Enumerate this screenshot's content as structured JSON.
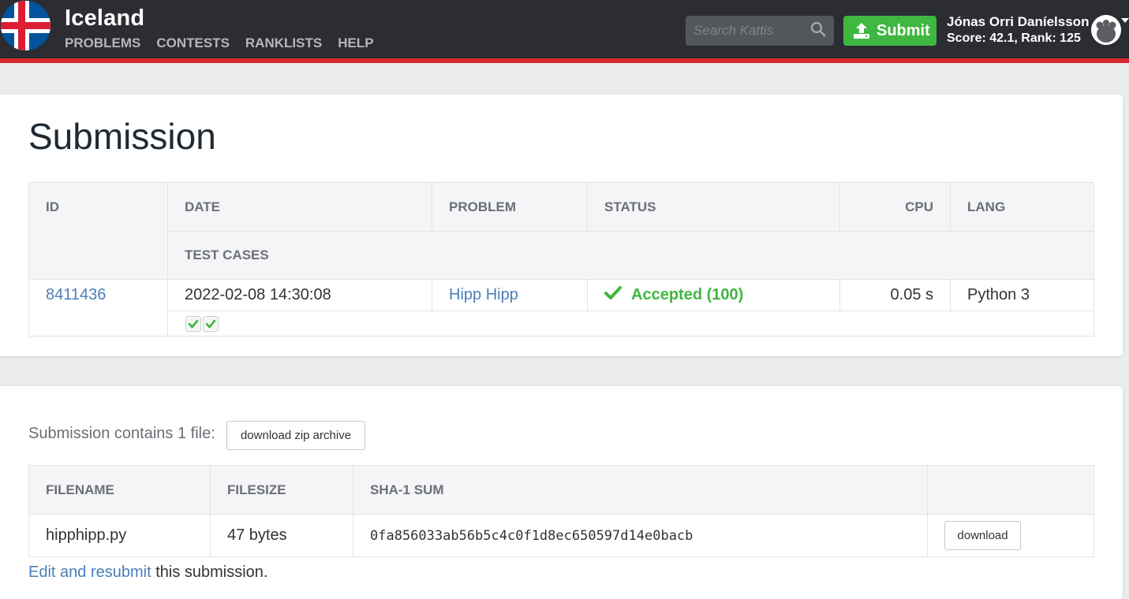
{
  "header": {
    "brand": "Iceland",
    "nav": [
      "PROBLEMS",
      "CONTESTS",
      "RANKLISTS",
      "HELP"
    ],
    "search_placeholder": "Search Kattis",
    "submit_label": "Submit",
    "user_name": "Jónas Orri Daníelsson",
    "user_score": "Score: 42.1, Rank: 125",
    "colors": {
      "bar": "#2b2d33",
      "accent_line": "#d7282f",
      "submit": "#3fb741"
    }
  },
  "page_title": "Submission",
  "submission_table": {
    "headers": {
      "id": "ID",
      "date": "DATE",
      "problem": "PROBLEM",
      "status": "STATUS",
      "cpu": "CPU",
      "lang": "LANG",
      "test_cases": "TEST CASES"
    },
    "row": {
      "id": "8411436",
      "date": "2022-02-08 14:30:08",
      "problem": "Hipp Hipp",
      "status": "Accepted (100)",
      "cpu": "0.05 s",
      "lang": "Python 3"
    },
    "test_cases": [
      "accepted",
      "accepted"
    ]
  },
  "files_section": {
    "contains_text": "Submission contains 1 file:",
    "zip_button": "download zip archive",
    "headers": {
      "filename": "FILENAME",
      "filesize": "FILESIZE",
      "sha": "SHA-1 SUM",
      "action": ""
    },
    "rows": [
      {
        "filename": "hipphipp.py",
        "filesize": "47 bytes",
        "sha": "0fa856033ab56b5c4c0f1d8ec650597d14e0bacb",
        "download": "download"
      }
    ]
  },
  "footer_line": {
    "link_text": "Edit and resubmit",
    "rest_text": " this submission."
  }
}
